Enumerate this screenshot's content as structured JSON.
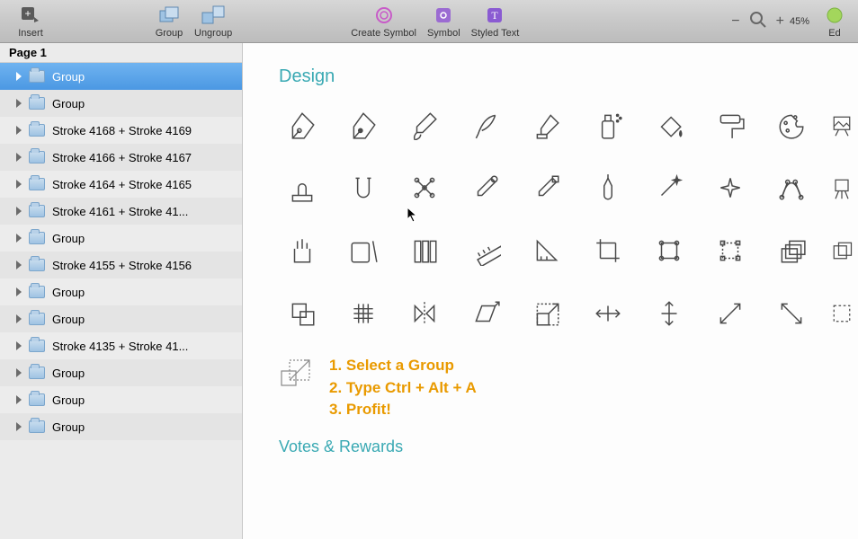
{
  "toolbar": {
    "insert": "Insert",
    "group": "Group",
    "ungroup": "Ungroup",
    "create_symbol": "Create Symbol",
    "symbol": "Symbol",
    "styled_text": "Styled Text",
    "zoom_minus": "−",
    "zoom_plus": "+",
    "zoom_value": "45%",
    "edit_partial": "Ed"
  },
  "sidebar": {
    "page_title": "Page 1",
    "items": [
      {
        "label": "Group",
        "selected": true
      },
      {
        "label": "Group"
      },
      {
        "label": "Stroke 4168 + Stroke 4169"
      },
      {
        "label": "Stroke 4166 + Stroke 4167"
      },
      {
        "label": "Stroke 4164 + Stroke 4165"
      },
      {
        "label": "Stroke 4161 + Stroke 41..."
      },
      {
        "label": "Group"
      },
      {
        "label": "Stroke 4155 + Stroke 4156"
      },
      {
        "label": "Group"
      },
      {
        "label": "Group"
      },
      {
        "label": "Stroke 4135 + Stroke 41..."
      },
      {
        "label": "Group"
      },
      {
        "label": "Group"
      },
      {
        "label": "Group"
      }
    ]
  },
  "canvas": {
    "section1_title": "Design",
    "section2_title": "Votes & Rewards",
    "icons_row1": [
      "pen-nib",
      "pen-nib-alt",
      "brush",
      "quill",
      "highlighter",
      "spray-can",
      "paint-bucket",
      "paint-roller",
      "palette",
      "painting"
    ],
    "icons_row2": [
      "stamp",
      "magnet",
      "nodes",
      "dropper",
      "dropper-alt",
      "ink-dropper",
      "magic-wand",
      "sparkle",
      "bezier",
      "easel"
    ],
    "icons_row3": [
      "pen-cup",
      "tablet-stylus",
      "swatches",
      "ruler",
      "triangle-ruler",
      "crop",
      "transform",
      "bounding-box",
      "layers",
      "layers-alt"
    ],
    "icons_row4": [
      "subtract",
      "grid",
      "mirror",
      "shear",
      "scale",
      "width-arrows",
      "height-arrows",
      "expand",
      "collapse",
      "marquee"
    ],
    "instructions": {
      "step1": "1. Select a Group",
      "step2": "2. Type Ctrl + Alt + A",
      "step3": "3. Profit!"
    }
  }
}
